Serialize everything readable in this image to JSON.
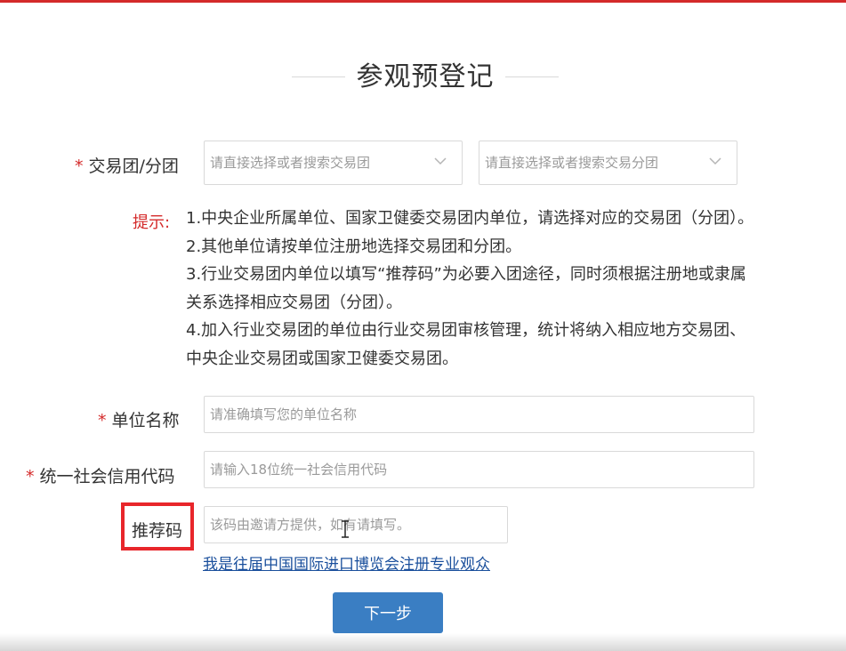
{
  "header": {
    "title": "参观预登记"
  },
  "form": {
    "trade_group": {
      "required_mark": "*",
      "label": "交易团/分团",
      "group_placeholder": "请直接选择或者搜索交易团",
      "subgroup_placeholder": "请直接选择或者搜索交易分团"
    },
    "tips": {
      "label": "提示:",
      "lines": [
        "1.中央企业所属单位、国家卫健委交易团内单位，请选择对应的交易团（分团）。",
        "2.其他单位请按单位注册地选择交易团和分团。",
        "3.行业交易团内单位以填写“推荐码”为必要入团途径，同时须根据注册地或隶属",
        "关系选择相应交易团（分团）。",
        "4.加入行业交易团的单位由行业交易团审核管理，统计将纳入相应地方交易团、",
        "中央企业交易团或国家卫健委交易团。"
      ]
    },
    "unit_name": {
      "required_mark": "*",
      "label": "单位名称",
      "placeholder": "请准确填写您的单位名称"
    },
    "credit_code": {
      "required_mark": "*",
      "label": "统一社会信用代码",
      "placeholder": "请输入18位统一社会信用代码"
    },
    "referral_code": {
      "label": "推荐码",
      "placeholder": "该码由邀请方提供，如有请填写。"
    },
    "past_visitor_link": "我是往届中国国际进口博览会注册专业观众",
    "next_button": "下一步"
  },
  "colors": {
    "accent_red": "#d42a2a",
    "highlight_red": "#e8262b",
    "button_blue": "#3a7ec3",
    "link_blue": "#1a4f9c"
  },
  "icons": {
    "select_chevron": "chevron-down-icon",
    "text_cursor": "text-cursor-icon"
  }
}
